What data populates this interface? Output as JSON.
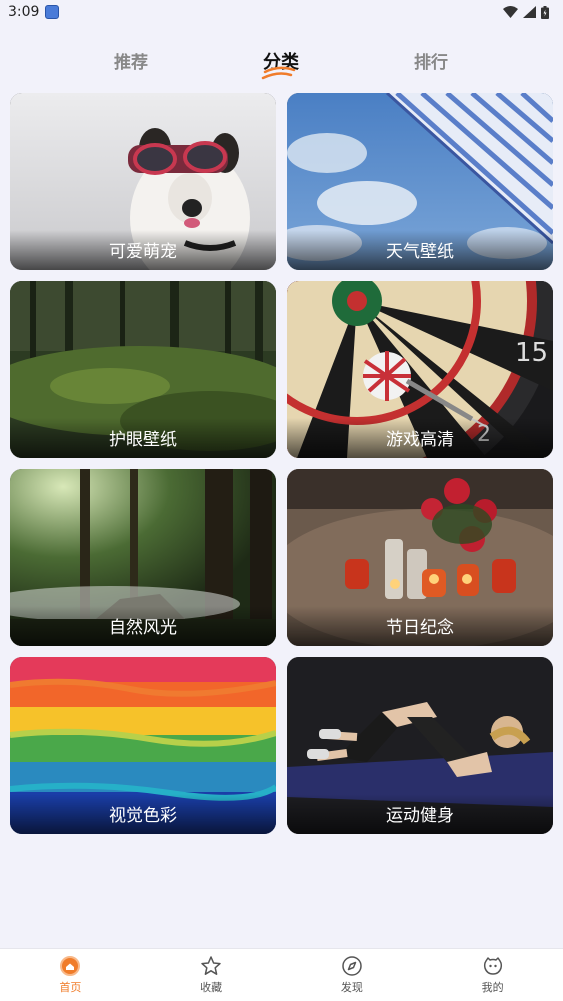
{
  "status": {
    "time": "3:09"
  },
  "tabs": [
    {
      "label": "推荐"
    },
    {
      "label": "分类",
      "active": true
    },
    {
      "label": "排行"
    }
  ],
  "categories": [
    {
      "label": "可爱萌宠",
      "icon": "dog-photo"
    },
    {
      "label": "天气壁纸",
      "icon": "sky-umbrella-photo"
    },
    {
      "label": "护眼壁纸",
      "icon": "forest-photo"
    },
    {
      "label": "游戏高清",
      "icon": "dartboard-photo"
    },
    {
      "label": "自然风光",
      "icon": "misty-forest-photo"
    },
    {
      "label": "节日纪念",
      "icon": "candles-roses-photo"
    },
    {
      "label": "视觉色彩",
      "icon": "rainbow-paint-photo"
    },
    {
      "label": "运动健身",
      "icon": "workout-photo"
    }
  ],
  "nav": [
    {
      "label": "首页",
      "icon": "home-icon",
      "active": true
    },
    {
      "label": "收藏",
      "icon": "star-icon"
    },
    {
      "label": "发现",
      "icon": "compass-icon"
    },
    {
      "label": "我的",
      "icon": "face-icon"
    }
  ],
  "colors": {
    "accent": "#f07c2a",
    "background": "#f2f2fa"
  }
}
